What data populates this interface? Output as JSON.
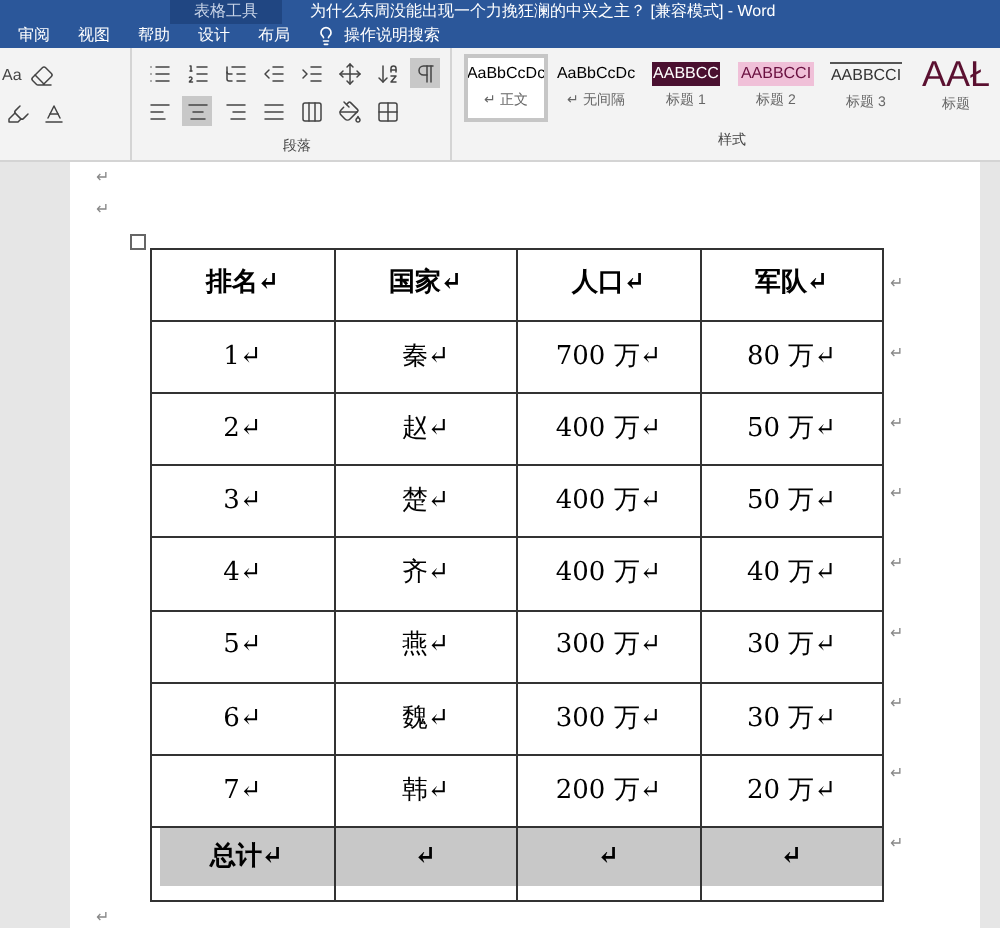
{
  "window": {
    "context_tab": "表格工具",
    "title": "为什么东周没能出现一个力挽狂澜的中兴之主？ [兼容模式] - Word"
  },
  "tabs": [
    {
      "label": "审阅",
      "selected": false
    },
    {
      "label": "视图",
      "selected": false
    },
    {
      "label": "帮助",
      "selected": false
    },
    {
      "label": "设计",
      "selected": false
    },
    {
      "label": "布局",
      "selected": false
    }
  ],
  "tell_me": {
    "placeholder": "操作说明搜索"
  },
  "ribbon": {
    "font_size_label": "Aa",
    "paragraph_group": "段落",
    "styles_group": "样式",
    "styles": [
      {
        "preview": "AaBbCcDc",
        "name": "↵ 正文",
        "kind": "normal",
        "selected": true
      },
      {
        "preview": "AaBbCcDc",
        "name": "↵ 无间隔",
        "kind": "normal",
        "selected": false
      },
      {
        "preview": "AABBCC",
        "name": "标题 1",
        "kind": "dark",
        "selected": false
      },
      {
        "preview": "AABBCCI",
        "name": "标题 2",
        "kind": "pink",
        "selected": false
      },
      {
        "preview": "AABBCCI",
        "name": "标题 3",
        "kind": "line",
        "selected": false
      },
      {
        "preview": "AAŁ",
        "name": "标题",
        "kind": "big",
        "selected": false
      }
    ]
  },
  "document": {
    "marks_before": [
      "↵",
      "↵"
    ],
    "table": {
      "header": [
        "排名↵",
        "国家↵",
        "人口↵",
        "军队↵"
      ],
      "rows": [
        [
          "1↵",
          "秦↵",
          "700 万↵",
          "80 万↵"
        ],
        [
          "2↵",
          "赵↵",
          "400 万↵",
          "50 万↵"
        ],
        [
          "3↵",
          "楚↵",
          "400 万↵",
          "50 万↵"
        ],
        [
          "4↵",
          "齐↵",
          "400 万↵",
          "40 万↵"
        ],
        [
          "5↵",
          "燕↵",
          "300 万↵",
          "30 万↵"
        ],
        [
          "6↵",
          "魏↵",
          "300 万↵",
          "30 万↵"
        ],
        [
          "7↵",
          "韩↵",
          "200 万↵",
          "20 万↵"
        ]
      ],
      "total": [
        "总计↵",
        "↵",
        "↵",
        "↵"
      ],
      "row_end_mark": "↵"
    },
    "mark_after": "↵"
  }
}
